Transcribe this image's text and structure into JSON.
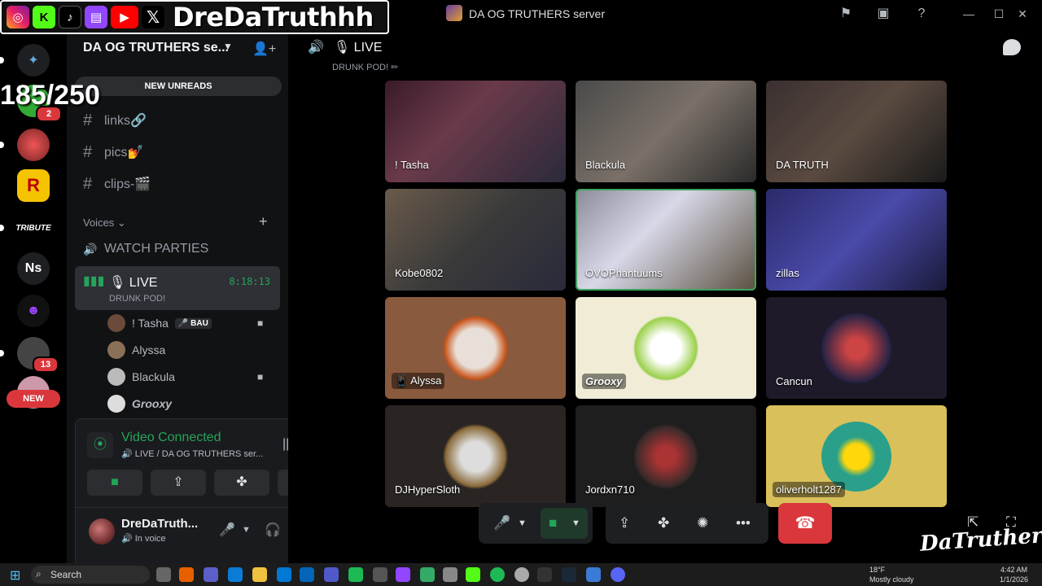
{
  "window": {
    "title": "DA OG TRUTHERS server"
  },
  "overlay": {
    "handle": "DreDaTruthhh",
    "counter": "185/250"
  },
  "rail": {
    "badges": [
      "2",
      "13"
    ],
    "server_ns": "Ns",
    "new_label": "NEW",
    "tribute": "TRIBUTE"
  },
  "sidebar": {
    "server_name": "DA OG TRUTHERS se...",
    "new_unreads": "NEW UNREADS",
    "channels": [
      "links🔗",
      "pics💅",
      "clips-🎬"
    ],
    "voices_category": "Voices",
    "watch_parties": "WATCH PARTIES",
    "live_channel": {
      "name": "🎙 LIVE",
      "timer": "8:18:13",
      "sub": "DRUNK POD!"
    },
    "voice_users": [
      {
        "name": "! Tasha",
        "badge": "🎤 BAU"
      },
      {
        "name": "Alyssa"
      },
      {
        "name": "Blackula"
      },
      {
        "name": "Grooxy"
      }
    ]
  },
  "voice_panel": {
    "title": "Video Connected",
    "sub": "🔊 LIVE / DA OG TRUTHERS ser...",
    "user": "DreDaTruth...",
    "status": "🔊 In voice"
  },
  "stage": {
    "channel": "🎙 LIVE",
    "topic": "DRUNK POD! ✏",
    "tiles": [
      {
        "name": "! Tasha"
      },
      {
        "name": "Blackula"
      },
      {
        "name": "DA TRUTH"
      },
      {
        "name": "Kobe0802"
      },
      {
        "name": "OVOPhantuums"
      },
      {
        "name": "zillas"
      },
      {
        "name": "📱 Alyssa"
      },
      {
        "name": "Grooxy"
      },
      {
        "name": "Cancun"
      },
      {
        "name": "DJHyperSloth"
      },
      {
        "name": "Jordxn710"
      },
      {
        "name": "oliverholt1287"
      }
    ],
    "watermark": "DaTruthers"
  },
  "taskbar": {
    "search": "Search",
    "weather_temp": "18°F",
    "weather_desc": "Mostly cloudy",
    "time": "4:42 AM",
    "date": "1/1/2026"
  },
  "colors": {
    "accent_green": "#23a55a",
    "danger_red": "#da373c",
    "sidebar_bg": "#111214"
  }
}
